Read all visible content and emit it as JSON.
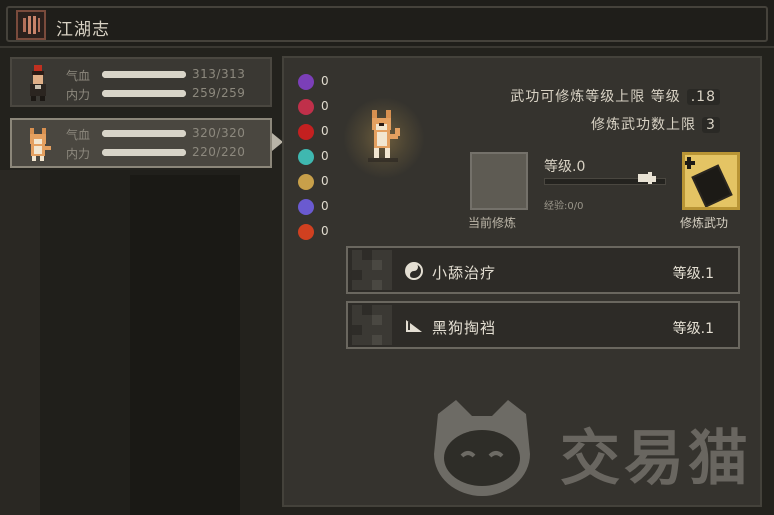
{
  "window": {
    "title": "江湖志"
  },
  "characters": [
    {
      "name": "hero",
      "hp_label": "气血",
      "hp_text": "313/313",
      "hp_fraction": 1.0,
      "mp_label": "内力",
      "mp_text": "259/259",
      "mp_fraction": 1.0,
      "selected": false
    },
    {
      "name": "dog",
      "hp_label": "气血",
      "hp_text": "320/320",
      "hp_fraction": 1.0,
      "mp_label": "内力",
      "mp_text": "220/220",
      "mp_fraction": 1.0,
      "selected": true
    }
  ],
  "status_effects": [
    {
      "icon": "purple-skull-icon",
      "color": "#7b3fb8",
      "count": "0"
    },
    {
      "icon": "broken-heart-icon",
      "color": "#c0304a",
      "count": "0"
    },
    {
      "icon": "red-burst-icon",
      "color": "#c42020",
      "count": "0"
    },
    {
      "icon": "cyan-skull-icon",
      "color": "#3fb8b0",
      "count": "0"
    },
    {
      "icon": "sparkle-icon",
      "color": "#c8a04a",
      "count": "0"
    },
    {
      "icon": "blue-orb-icon",
      "color": "#6a5ad0",
      "count": "0"
    },
    {
      "icon": "flame-icon",
      "color": "#d04020",
      "count": "0"
    }
  ],
  "training": {
    "max_level_label": "武功可修炼等级上限 等级",
    "max_level_value": ".18",
    "max_count_label": "修炼武功数上限",
    "max_count_value": "3",
    "current_slot_label": "当前修炼",
    "level_label": "等级.0",
    "xp_label": "经验:0/0",
    "xp_fraction": 0,
    "train_button_label": "修炼武功"
  },
  "skills": [
    {
      "icon": "yin-yang-icon",
      "name": "小舔治疗",
      "level": "等级.1"
    },
    {
      "icon": "claw-icon",
      "name": "黑狗掏裆",
      "level": "等级.1"
    }
  ],
  "watermark": {
    "text": "交易猫"
  },
  "colors": {
    "accent_gold": "#e4c464",
    "panel": "#35332e",
    "text": "#d8d2c4"
  }
}
